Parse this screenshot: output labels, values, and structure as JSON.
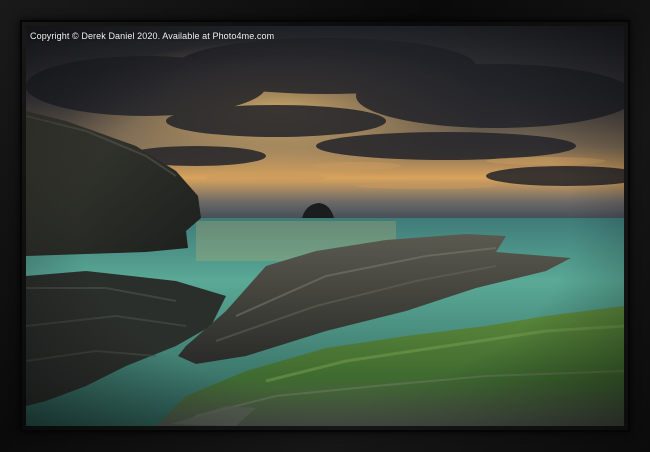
{
  "image": {
    "copyright_text": "Copyright © Derek Daniel 2020. Available at Photo4me.com",
    "scene": "coastal-sunset-seascape",
    "colors": {
      "frame": "#111111",
      "sky_dark": "#2b2c34",
      "sky_glow": "#e0a85a",
      "sea": "#4fa58f",
      "rock": "#3a3a34",
      "moss": "#4f7a34"
    }
  }
}
